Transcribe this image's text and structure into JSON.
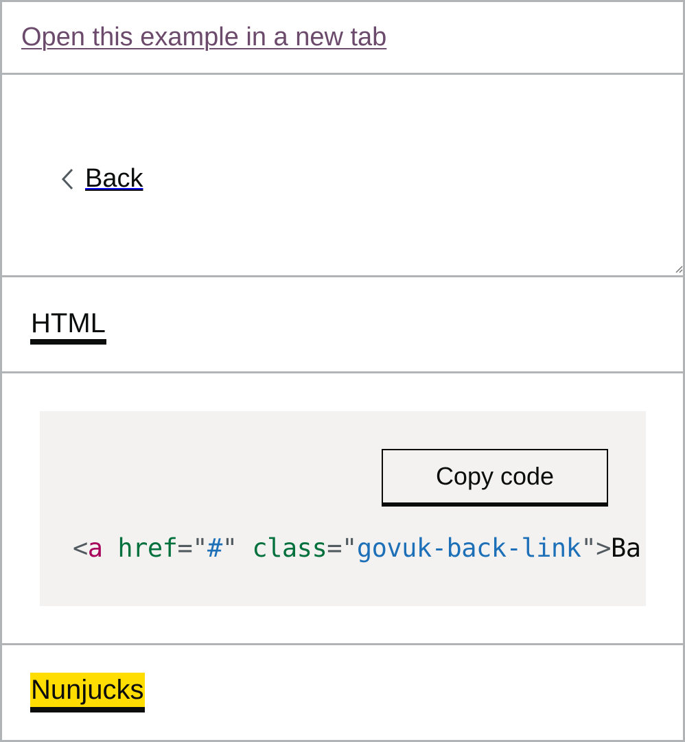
{
  "open_link": {
    "label": "Open this example in a new tab"
  },
  "preview": {
    "back_link_label": "Back"
  },
  "tabs": [
    {
      "label": "HTML",
      "state": "active"
    },
    {
      "label": "Nunjucks",
      "state": "focused"
    }
  ],
  "code": {
    "copy_button_label": "Copy code",
    "tokens": {
      "open": "<",
      "tag": "a",
      "attr1": "href",
      "eq1": "=",
      "q1a": "\"",
      "val1": "#",
      "q1b": "\"",
      "attr2": "class",
      "eq2": "=",
      "q2a": "\"",
      "val2": "govuk-back-link",
      "q2b": "\"",
      "close": ">",
      "text": "Back</a>"
    }
  },
  "colors": {
    "link_visited": "#6b4a6b",
    "focus_yellow": "#ffdd00",
    "code_bg": "#f3f2f1",
    "border": "#b1b4b6"
  },
  "icons": [
    "chevron-left-icon",
    "resize-handle-icon"
  ]
}
